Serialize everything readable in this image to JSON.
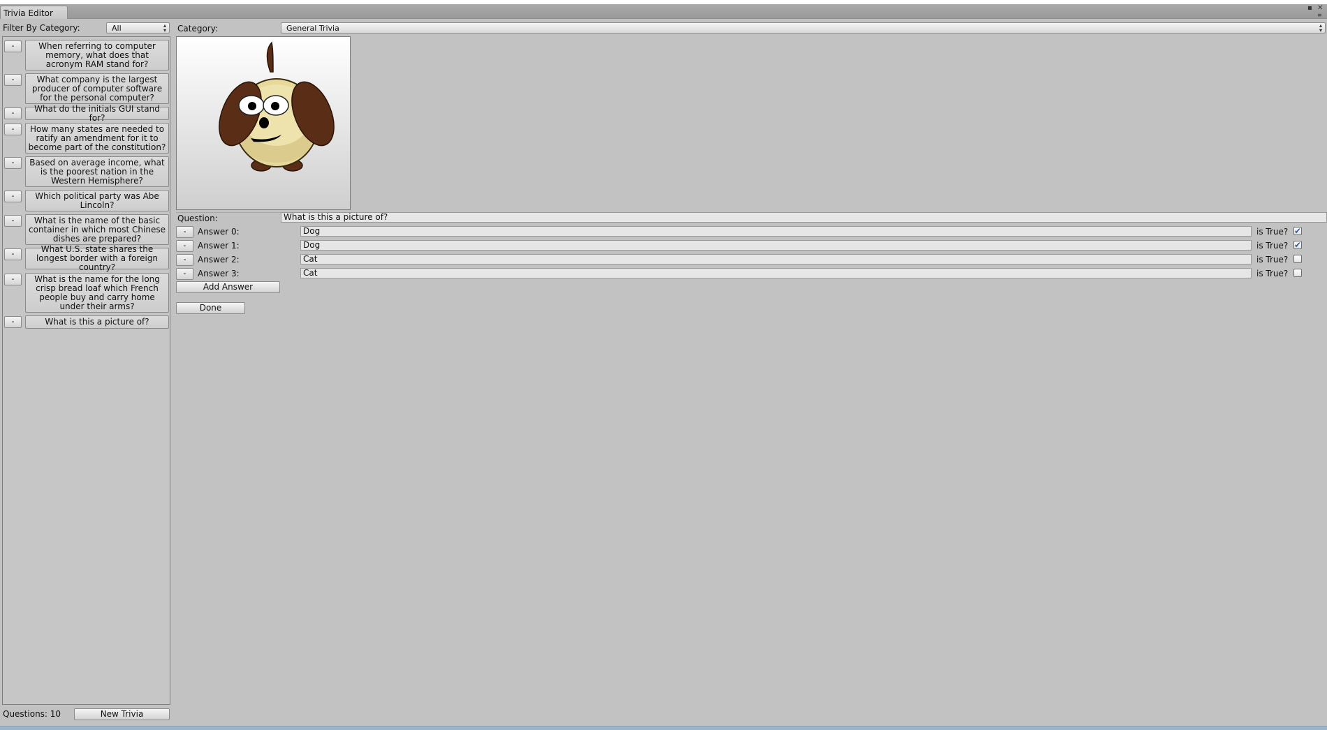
{
  "window": {
    "tab_title": "Trivia Editor",
    "maximize_glyph": "▪",
    "close_glyph": "✕",
    "menu_glyph": "≡"
  },
  "filter": {
    "label": "Filter By Category:",
    "value": "All"
  },
  "questions_list": [
    {
      "remove_label": "-",
      "text": "When referring to computer memory, what does that acronym RAM stand for?"
    },
    {
      "remove_label": "-",
      "text": "What company is the largest producer of computer software for the personal computer?"
    },
    {
      "remove_label": "-",
      "text": "What do the initials GUI stand for?"
    },
    {
      "remove_label": "-",
      "text": "How many states are needed to ratify an amendment for it to become part of the constitution?"
    },
    {
      "remove_label": "-",
      "text": "Based on average income, what is the poorest nation in the Western Hemisphere?"
    },
    {
      "remove_label": "-",
      "text": "Which political party was Abe Lincoln?"
    },
    {
      "remove_label": "-",
      "text": "What is the name of the basic container in which most Chinese dishes are prepared?"
    },
    {
      "remove_label": "-",
      "text": "What U.S. state shares the longest border with a foreign country?"
    },
    {
      "remove_label": "-",
      "text": "What is the name for the long crisp bread loaf which French people buy and carry home under their arms?"
    },
    {
      "remove_label": "-",
      "text": "What is this a picture of?"
    }
  ],
  "footer": {
    "count_text": "Questions: 10",
    "new_button": "New Trivia"
  },
  "editor": {
    "category_label": "Category:",
    "category_value": "General Trivia",
    "question_label": "Question:",
    "question_value": "What is this a picture of?",
    "answers": [
      {
        "remove_label": "-",
        "label": "Answer 0:",
        "value": "Dog",
        "true_label": "is True?",
        "is_true": true
      },
      {
        "remove_label": "-",
        "label": "Answer 1:",
        "value": "Dog",
        "true_label": "is True?",
        "is_true": true
      },
      {
        "remove_label": "-",
        "label": "Answer 2:",
        "value": "Cat",
        "true_label": "is True?",
        "is_true": false
      },
      {
        "remove_label": "-",
        "label": "Answer 3:",
        "value": "Cat",
        "true_label": "is True?",
        "is_true": false
      }
    ],
    "add_answer_button": "Add Answer",
    "done_button": "Done"
  },
  "colors": {
    "background": "#c2c2c2",
    "checkbox_check": "#2a5ba8",
    "dog_body": "#e7d99a",
    "dog_ear": "#5a2d16"
  },
  "icons": {
    "popup_arrows": "popup-arrows-icon",
    "checkmark": "checkmark-icon",
    "picture": "dog-picture-icon"
  }
}
